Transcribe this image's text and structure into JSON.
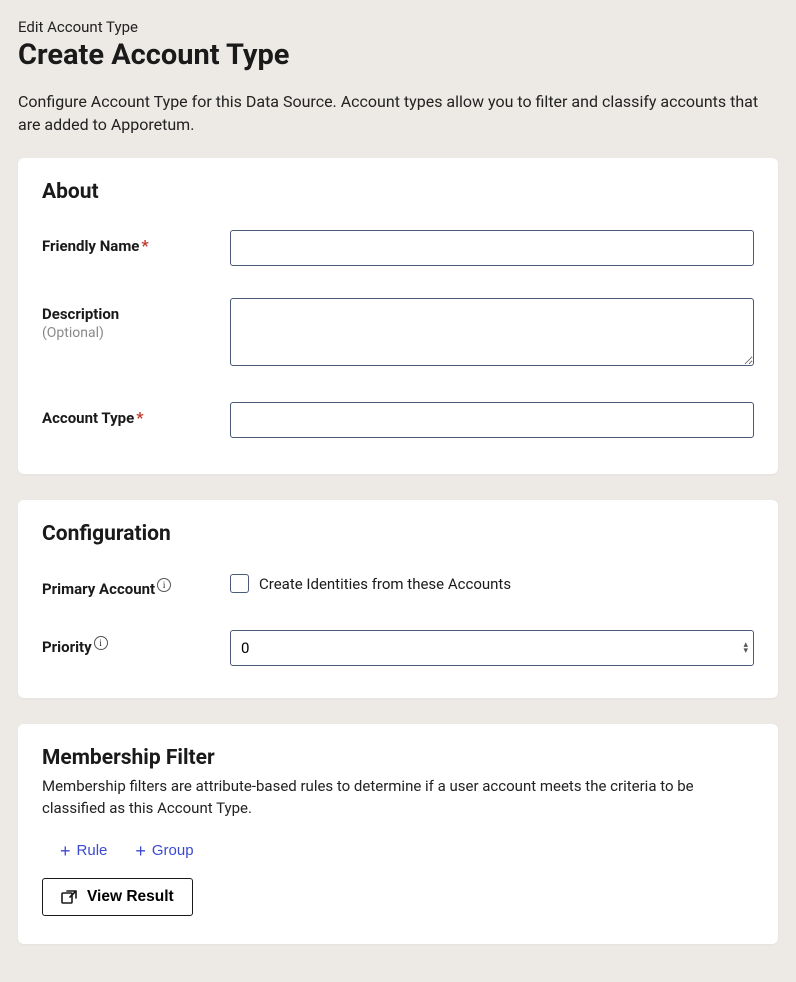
{
  "breadcrumb": "Edit Account Type",
  "page_title": "Create Account Type",
  "page_desc": "Configure Account Type for this Data Source. Account types allow you to filter and classify accounts that are added to Apporetum.",
  "about": {
    "heading": "About",
    "friendly_name_label": "Friendly Name",
    "friendly_name_value": "",
    "description_label": "Description",
    "optional_text": "(Optional)",
    "description_value": "",
    "account_type_label": "Account Type",
    "account_type_value": ""
  },
  "config": {
    "heading": "Configuration",
    "primary_account_label": "Primary Account",
    "primary_checkbox_label": "Create Identities from these Accounts",
    "priority_label": "Priority",
    "priority_value": "0"
  },
  "filter": {
    "heading": "Membership Filter",
    "desc": "Membership filters are attribute-based rules to determine if a user account meets the criteria to be classified as this Account Type.",
    "rule_label": "Rule",
    "group_label": "Group",
    "view_result_label": "View Result"
  }
}
